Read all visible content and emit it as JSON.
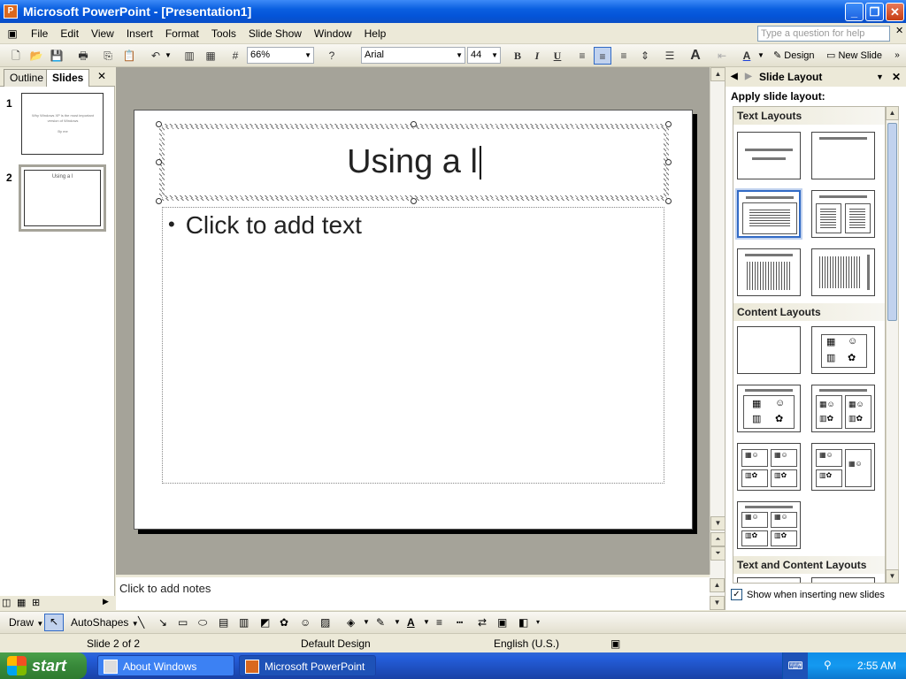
{
  "window": {
    "title": "Microsoft PowerPoint - [Presentation1]",
    "minimize": "_",
    "restore": "❐",
    "close": "✕"
  },
  "menu": {
    "items": [
      "File",
      "Edit",
      "View",
      "Insert",
      "Format",
      "Tools",
      "Slide Show",
      "Window",
      "Help"
    ],
    "question_placeholder": "Type a question for help"
  },
  "toolbar": {
    "zoom": "66%",
    "font": "Arial",
    "font_size": "44",
    "bold": "B",
    "italic": "I",
    "underline": "U",
    "design_label": "Design",
    "new_slide_label": "New Slide"
  },
  "left_pane": {
    "tabs": [
      "Outline",
      "Slides"
    ],
    "active_tab": "Slides",
    "close": "✕",
    "slides": [
      {
        "number": "1",
        "title": "Why Windows XP is the most important version of Windows",
        "subtitle": "By me"
      },
      {
        "number": "2",
        "title": "Using a l"
      }
    ],
    "selected_slide": 2
  },
  "slide": {
    "title_text": "Using a l",
    "body_text": "Click to add text",
    "bullet": "•"
  },
  "notes": {
    "placeholder": "Click to add notes"
  },
  "task_pane": {
    "title": "Slide Layout",
    "apply_label": "Apply slide layout:",
    "sections": [
      "Text Layouts",
      "Content Layouts",
      "Text and Content Layouts"
    ],
    "show_when_inserting": "Show when inserting new slides",
    "show_checked": true
  },
  "drawing_toolbar": {
    "draw": "Draw",
    "autoshapes": "AutoShapes"
  },
  "status_bar": {
    "slide_position": "Slide 2 of 2",
    "design": "Default Design",
    "language": "English (U.S.)"
  },
  "taskbar": {
    "start": "start",
    "buttons": [
      "About Windows",
      "Microsoft PowerPoint ..."
    ],
    "active_button": 1,
    "clock": "2:55 AM"
  }
}
